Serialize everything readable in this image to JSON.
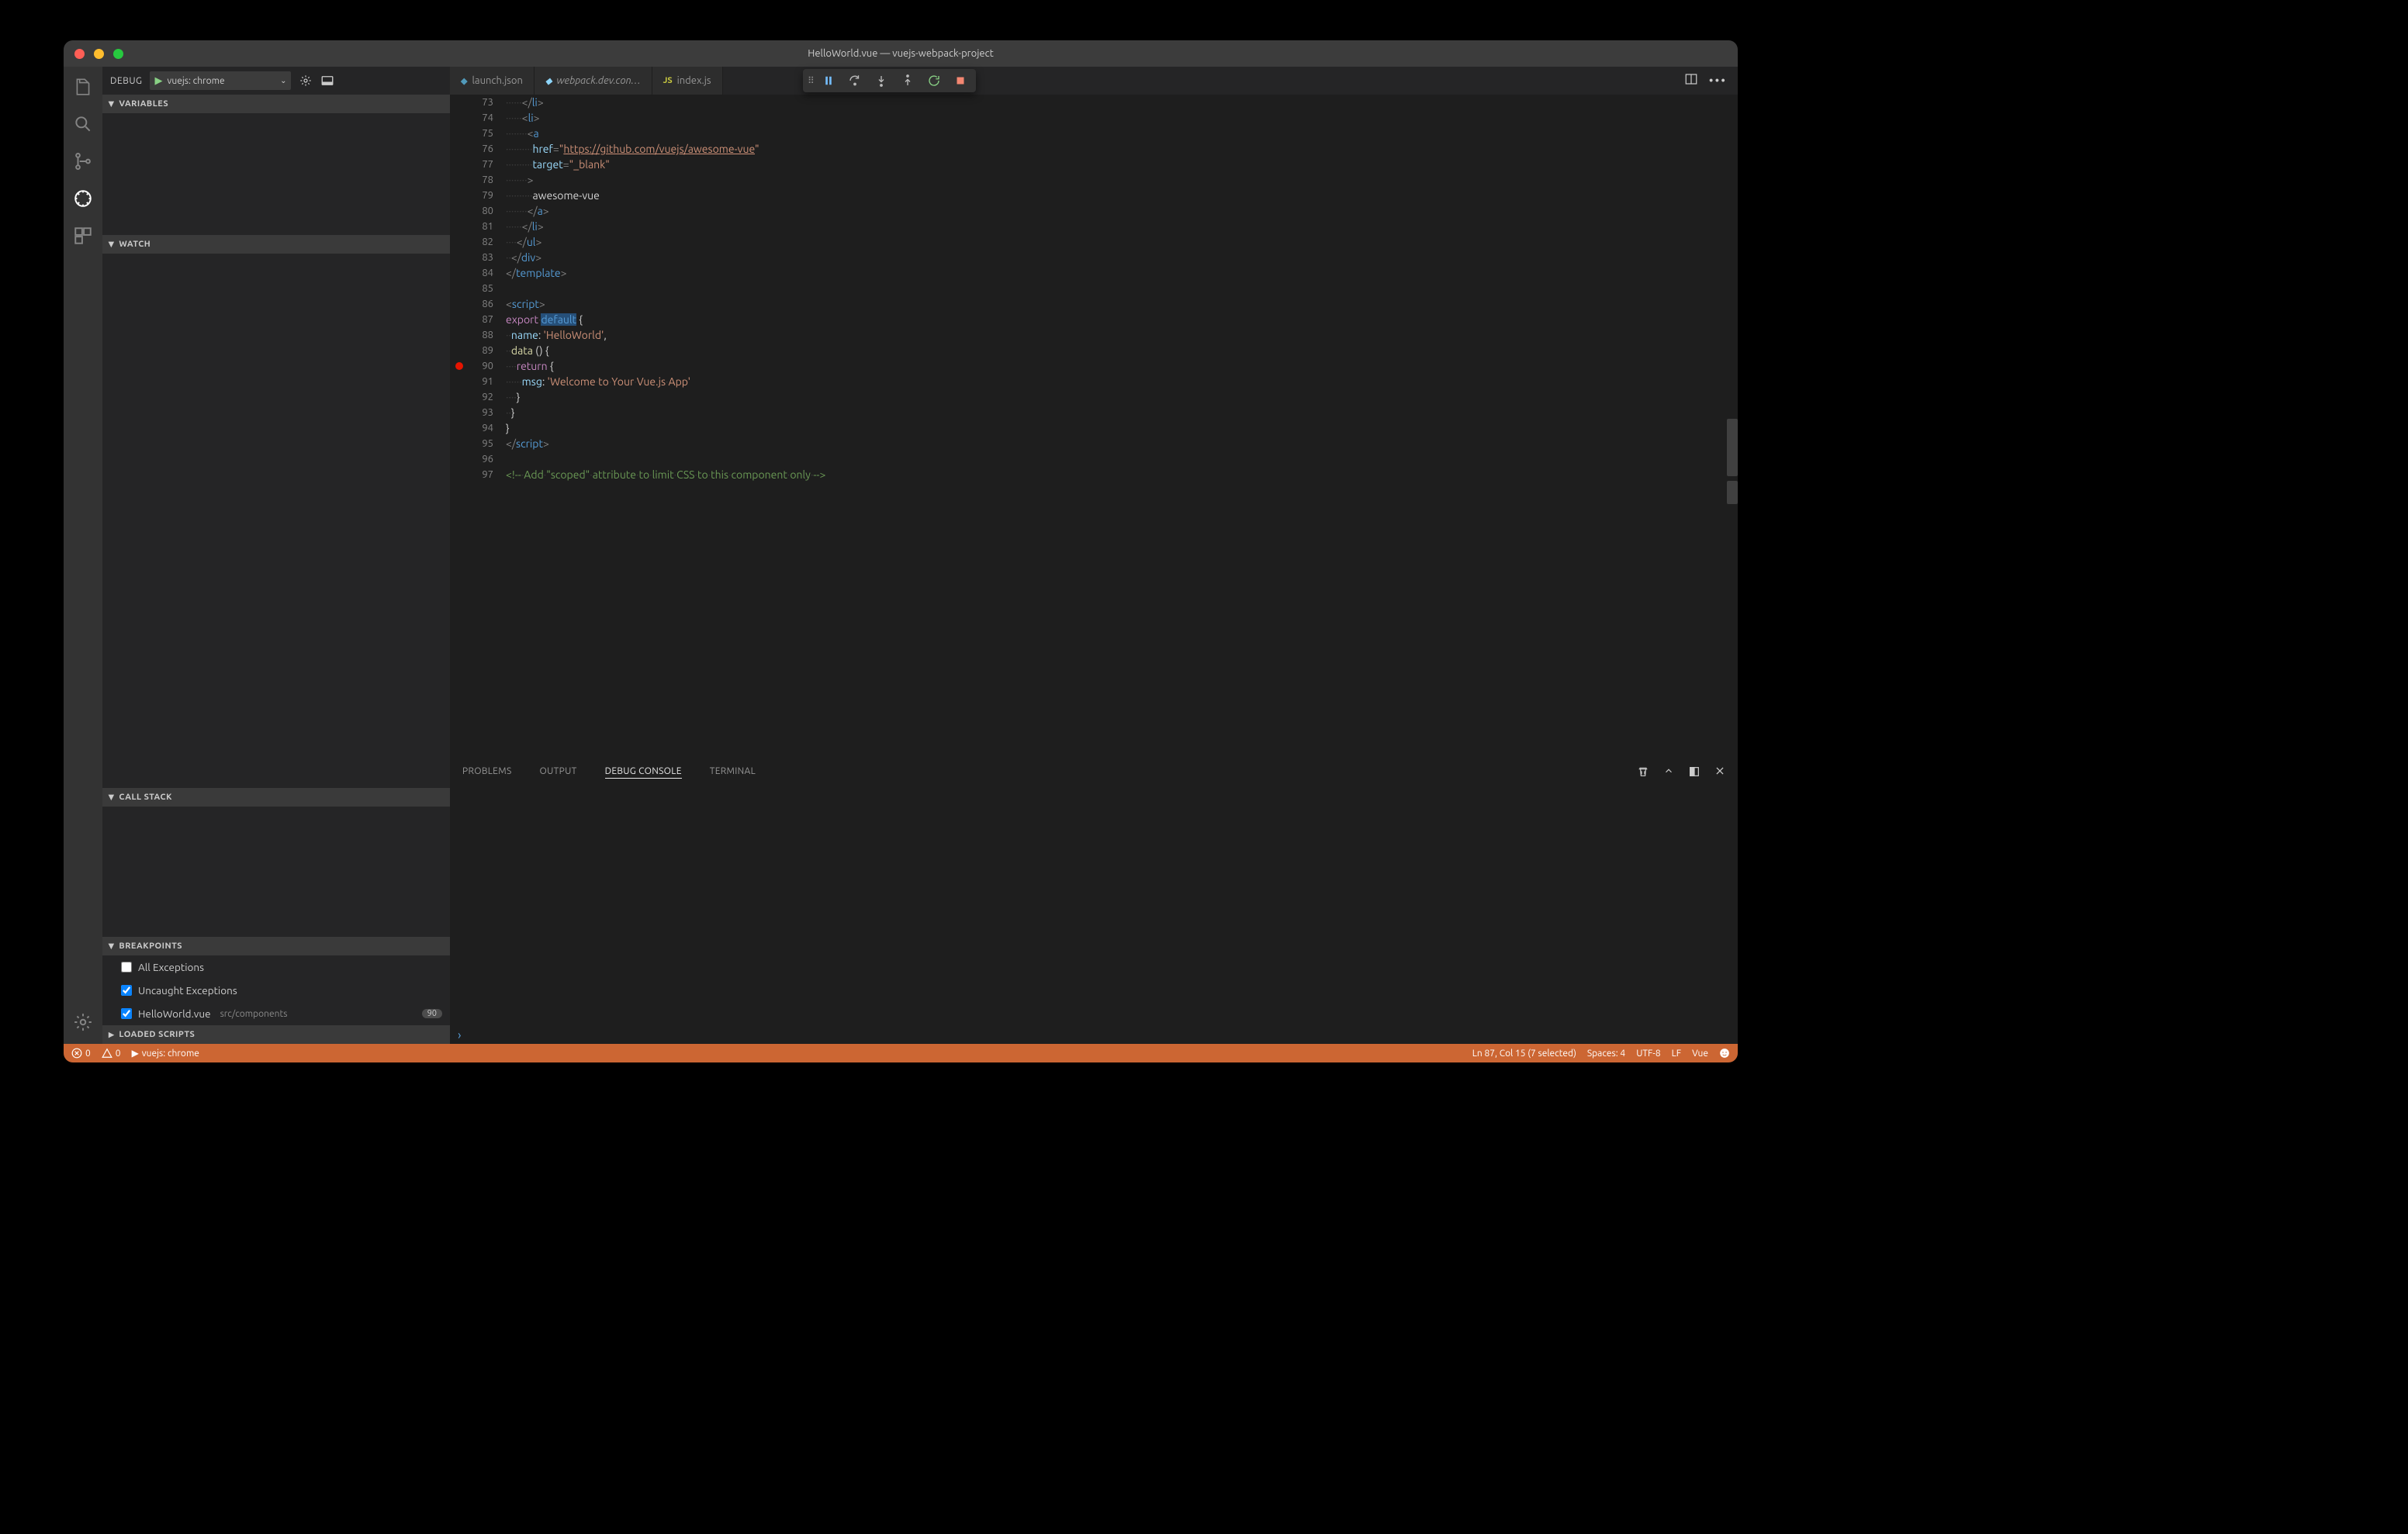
{
  "title": "HelloWorld.vue — vuejs-webpack-project",
  "debug": {
    "label": "DEBUG",
    "config": "vuejs: chrome",
    "sections": {
      "variables": "VARIABLES",
      "watch": "WATCH",
      "callstack": "CALL STACK",
      "breakpoints": "BREAKPOINTS",
      "loaded": "LOADED SCRIPTS"
    },
    "breakpoints": [
      {
        "label": "All Exceptions",
        "checked": false
      },
      {
        "label": "Uncaught Exceptions",
        "checked": true
      },
      {
        "label": "HelloWorld.vue",
        "hint": "src/components",
        "line": "90",
        "checked": true
      }
    ]
  },
  "tabs": [
    {
      "label": "launch.json",
      "icon": "vscode"
    },
    {
      "label": "webpack.dev.con…",
      "italic": true,
      "icon": "webpack"
    },
    {
      "label": "index.js",
      "icon": "js"
    }
  ],
  "panel": {
    "tabs": [
      "PROBLEMS",
      "OUTPUT",
      "DEBUG CONSOLE",
      "TERMINAL"
    ],
    "active": 2,
    "input_chevron": "›"
  },
  "code": [
    {
      "n": 73,
      "html": "<span class='whitespace-dot'>······</span><span class='tk-punct'>&lt;/</span><span class='tk-tag'>li</span><span class='tk-punct'>&gt;</span>"
    },
    {
      "n": 74,
      "html": "<span class='whitespace-dot'>······</span><span class='tk-punct'>&lt;</span><span class='tk-tag'>li</span><span class='tk-punct'>&gt;</span>"
    },
    {
      "n": 75,
      "html": "<span class='whitespace-dot'>········</span><span class='tk-punct'>&lt;</span><span class='tk-tag'>a</span>"
    },
    {
      "n": 76,
      "html": "<span class='whitespace-dot'>··········</span><span class='tk-attr'>href</span><span class='tk-punct'>=</span><span class='tk-str'>\"</span><span class='tk-str tk-underline'>https://github.com/vuejs/awesome-vue</span><span class='tk-str'>\"</span>"
    },
    {
      "n": 77,
      "html": "<span class='whitespace-dot'>··········</span><span class='tk-attr'>target</span><span class='tk-punct'>=</span><span class='tk-str'>\"_blank\"</span>"
    },
    {
      "n": 78,
      "html": "<span class='whitespace-dot'>········</span><span class='tk-punct'>&gt;</span>"
    },
    {
      "n": 79,
      "html": "<span class='whitespace-dot'>··········</span>awesome-vue"
    },
    {
      "n": 80,
      "html": "<span class='whitespace-dot'>········</span><span class='tk-punct'>&lt;/</span><span class='tk-tag'>a</span><span class='tk-punct'>&gt;</span>"
    },
    {
      "n": 81,
      "html": "<span class='whitespace-dot'>······</span><span class='tk-punct'>&lt;/</span><span class='tk-tag'>li</span><span class='tk-punct'>&gt;</span>"
    },
    {
      "n": 82,
      "html": "<span class='whitespace-dot'>····</span><span class='tk-punct'>&lt;/</span><span class='tk-tag'>ul</span><span class='tk-punct'>&gt;</span>"
    },
    {
      "n": 83,
      "html": "<span class='whitespace-dot'>··</span><span class='tk-punct'>&lt;/</span><span class='tk-tag'>div</span><span class='tk-punct'>&gt;</span>"
    },
    {
      "n": 84,
      "html": "<span class='tk-punct'>&lt;/</span><span class='tk-tag'>template</span><span class='tk-punct'>&gt;</span>"
    },
    {
      "n": 85,
      "html": ""
    },
    {
      "n": 86,
      "html": "<span class='tk-punct'>&lt;</span><span class='tk-tag'>script</span><span class='tk-punct'>&gt;</span>"
    },
    {
      "n": 87,
      "html": "<span class='tk-kw-export'>export</span><span class='whitespace-dot'>·</span><span class='tk-kw-default'>default</span> {"
    },
    {
      "n": 88,
      "html": "<span class='whitespace-dot'>··</span><span class='tk-prop'>name</span>: <span class='tk-str'>'HelloWorld'</span>,"
    },
    {
      "n": 89,
      "html": "<span class='whitespace-dot'>··</span><span class='tk-func'>data</span> () {"
    },
    {
      "n": 90,
      "html": "<span class='whitespace-dot'>····</span><span class='tk-kw-return'>return</span> {",
      "bp": true
    },
    {
      "n": 91,
      "html": "<span class='whitespace-dot'>······</span><span class='tk-prop'>msg</span>: <span class='tk-str'>'Welcome<span class=\"whitespace-dot\">·</span>to<span class=\"whitespace-dot\">·</span>Your<span class=\"whitespace-dot\">·</span>Vue.js<span class=\"whitespace-dot\">·</span>App'</span>"
    },
    {
      "n": 92,
      "html": "<span class='whitespace-dot'>····</span>}"
    },
    {
      "n": 93,
      "html": "<span class='whitespace-dot'>··</span>}"
    },
    {
      "n": 94,
      "html": "}"
    },
    {
      "n": 95,
      "html": "<span class='tk-punct'>&lt;/</span><span class='tk-tag'>script</span><span class='tk-punct'>&gt;</span>"
    },
    {
      "n": 96,
      "html": ""
    },
    {
      "n": 97,
      "html": "<span class='tk-comment'>&lt;!--<span class='whitespace-dot'>·</span>Add<span class='whitespace-dot'>·</span>\"scoped\"<span class='whitespace-dot'>·</span>attribute<span class='whitespace-dot'>·</span>to<span class='whitespace-dot'>·</span>limit<span class='whitespace-dot'>·</span>CSS<span class='whitespace-dot'>·</span>to<span class='whitespace-dot'>·</span>this<span class='whitespace-dot'>·</span>component<span class='whitespace-dot'>·</span>only<span class='whitespace-dot'>·</span>--&gt;</span>"
    }
  ],
  "status": {
    "errors": "0",
    "warnings": "0",
    "debug_launch": "vuejs: chrome",
    "cursor": "Ln 87, Col 15 (7 selected)",
    "spaces": "Spaces: 4",
    "encoding": "UTF-8",
    "eol": "LF",
    "language": "Vue"
  }
}
